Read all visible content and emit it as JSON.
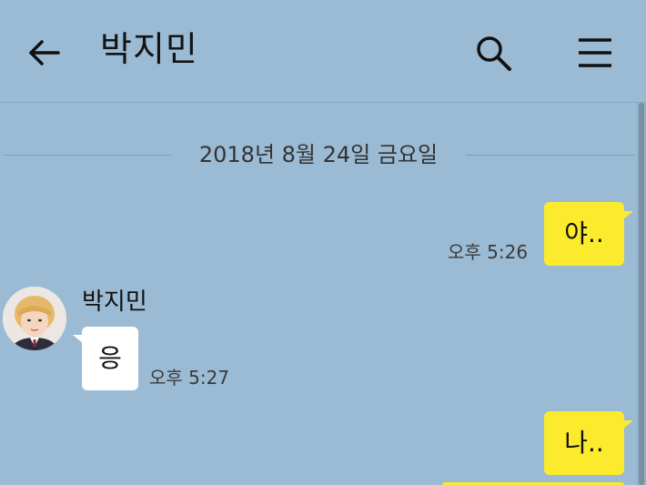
{
  "header": {
    "title": "박지민",
    "back_icon": "arrow-left-icon",
    "search_icon": "search-icon",
    "menu_icon": "hamburger-menu-icon"
  },
  "chat": {
    "date_divider": "2018년 8월 24일 금요일",
    "messages": [
      {
        "from": "me",
        "text": "야..",
        "time": "오후 5:26"
      },
      {
        "from": "other",
        "sender": "박지민",
        "text": "응",
        "time": "오후 5:27"
      },
      {
        "from": "me",
        "text": "나..",
        "time": ""
      }
    ]
  },
  "colors": {
    "background": "#9bbbd4",
    "my_bubble": "#fbeb2c",
    "other_bubble": "#ffffff"
  }
}
